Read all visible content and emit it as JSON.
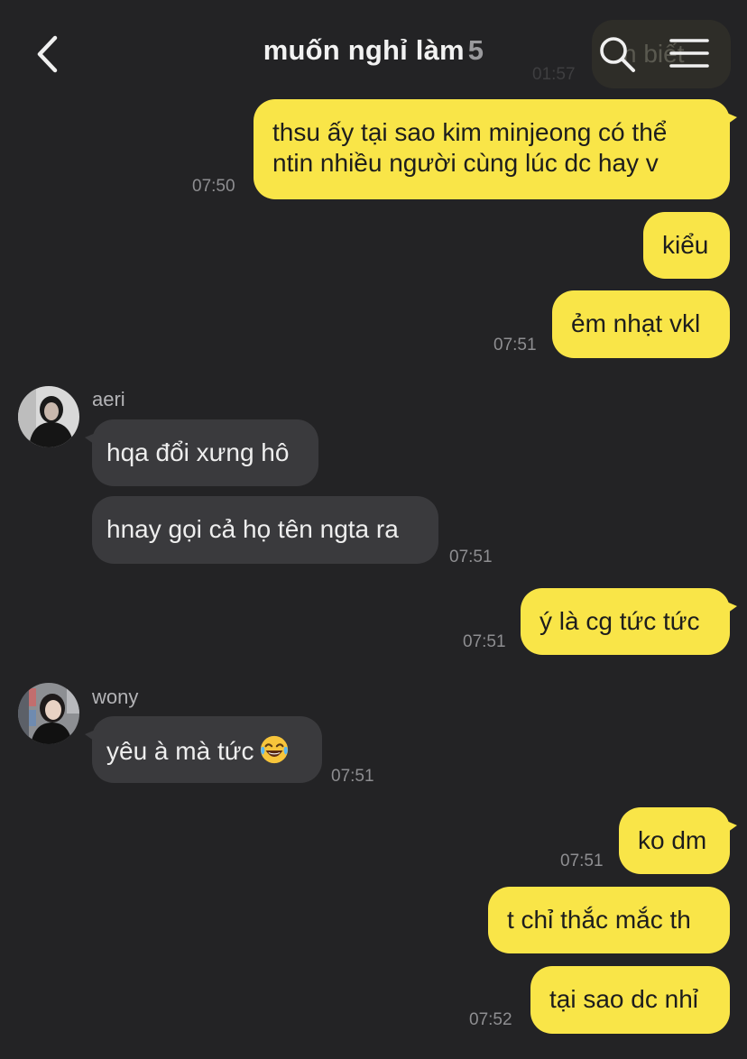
{
  "header": {
    "title": "muốn nghỉ làm",
    "member_count": "5",
    "back_icon": "chevron-left-icon",
    "search_icon": "search-icon",
    "menu_icon": "hamburger-menu-icon",
    "ghost_message_text": "n biết",
    "ghost_message_time": "01:57"
  },
  "colors": {
    "background": "#232325",
    "my_bubble": "#f9e548",
    "their_bubble": "#3a3a3d",
    "time_text": "#8e8e91"
  },
  "messages": [
    {
      "from": "me",
      "text_lines": [
        "thsu ấy tại sao kim minjeong có thể",
        "ntin nhiều người cùng lúc dc hay v"
      ],
      "time": "07:50"
    },
    {
      "from": "me",
      "text": "kiểu"
    },
    {
      "from": "me",
      "text": "ẻm nhạt vkl",
      "time": "07:51"
    },
    {
      "from": "aeri",
      "sender": "aeri",
      "text": "hqa đổi xưng hô"
    },
    {
      "from": "aeri",
      "text": "hnay gọi cả họ tên ngta ra",
      "time": "07:51"
    },
    {
      "from": "me",
      "text": "ý là cg tức tức",
      "time": "07:51"
    },
    {
      "from": "wony",
      "sender": "wony",
      "text": "yêu à mà tức",
      "emoji": "face-with-tears-of-joy",
      "time": "07:51"
    },
    {
      "from": "me",
      "text": "ko dm",
      "time": "07:51"
    },
    {
      "from": "me",
      "text": "t chỉ thắc mắc th"
    },
    {
      "from": "me",
      "text": "tại sao dc nhỉ",
      "time": "07:52"
    }
  ]
}
